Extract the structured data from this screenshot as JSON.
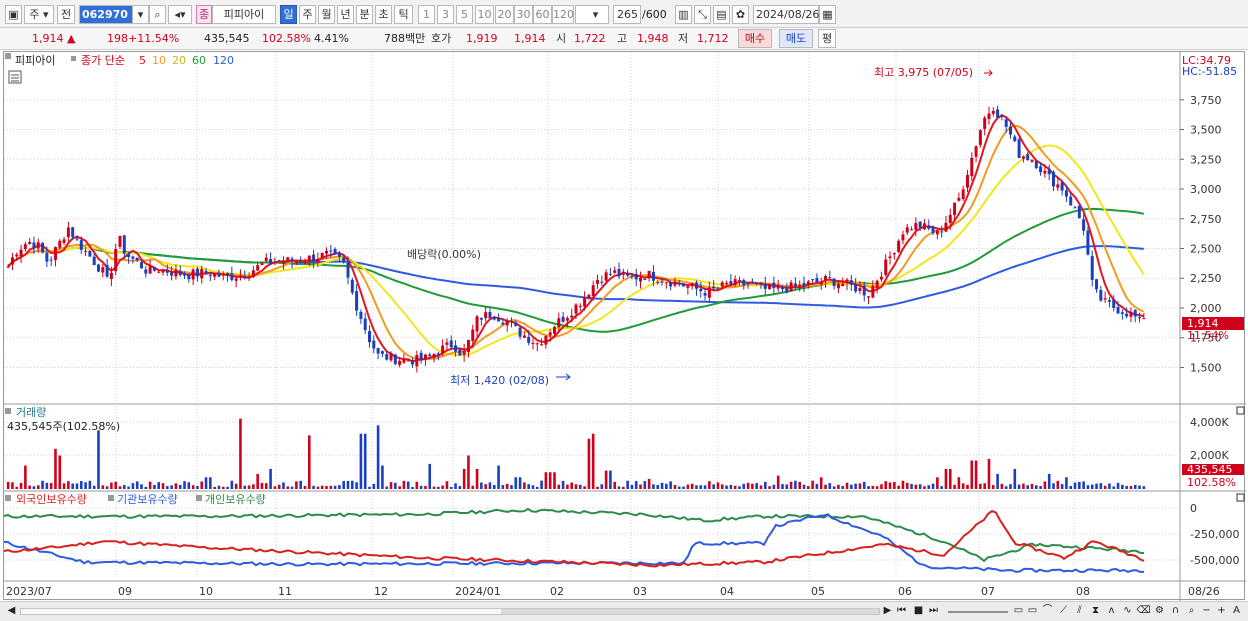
{
  "toolbar": {
    "market_type": "주",
    "prev_label": "전",
    "stock_code": "062970",
    "stock_badge": "종",
    "stock_name": "피피아이",
    "periods": [
      "일",
      "주",
      "월",
      "년",
      "분",
      "초",
      "틱"
    ],
    "active_period": "일",
    "intervals": [
      "1",
      "3",
      "5",
      "10",
      "20",
      "30",
      "60",
      "120"
    ],
    "count": "265",
    "count_total": "/600",
    "date": "2024/08/26"
  },
  "quote": {
    "price": "1,914",
    "change": "198",
    "change_pct": "+11.54%",
    "volume": "435,545",
    "volume_ratio": "102.58%",
    "turnover": "4.41%",
    "amount": "788백만",
    "ask_label": "호가",
    "ask": "1,919",
    "bid": "1,914",
    "open_label": "시",
    "open": "1,722",
    "high_label": "고",
    "high": "1,948",
    "low_label": "저",
    "low": "1,712",
    "buy_label": "매수",
    "sell_label": "매도",
    "avg_label": "평"
  },
  "chart_legend": {
    "name": "피피아이",
    "series_label": "종가 단순",
    "ma": [
      "5",
      "10",
      "20",
      "60",
      "120"
    ]
  },
  "colors": {
    "up": "#d0021b",
    "down": "#1a3fbf",
    "ma5": "#e8141c",
    "ma10": "#f39a1f",
    "ma20": "#f3e61b",
    "ma60": "#1f9b3a",
    "ma120": "#2e5be0",
    "foreign": "#d9211c",
    "institution": "#2e5be0",
    "individual": "#2f8a4d"
  },
  "annotations": {
    "high": "최고 3,975 (07/05)",
    "low": "최저 1,420 (02/08)",
    "dividend": "배당락(0.00%)",
    "lc": "LC:34.79",
    "hc": "HC:-51.85",
    "last_price": "1,914",
    "last_pct": "11.54%"
  },
  "volume_panel": {
    "title": "거래량",
    "value": "435,545주(102.58%)",
    "last_vol": "435,545",
    "last_pct": "102.58%"
  },
  "holding_panel": {
    "foreign": "외국인보유수량",
    "institution": "기관보유수량",
    "individual": "개인보유수량"
  },
  "chart_data": [
    {
      "type": "candlestick",
      "x": [
        "2023/07",
        "09",
        "10",
        "11",
        "12",
        "2024/01",
        "02",
        "03",
        "04",
        "05",
        "06",
        "07",
        "08",
        "08/26"
      ],
      "price_axis_ticks": [
        "3,750",
        "3,500",
        "3,250",
        "3,000",
        "2,750",
        "2,500",
        "2,250",
        "2,000",
        "1,750",
        "1,500"
      ],
      "high_point": {
        "value": 3975,
        "date": "07/05"
      },
      "low_point": {
        "value": 1420,
        "date": "02/08"
      },
      "last_close": 1914
    },
    {
      "type": "bar",
      "name": "거래량",
      "volume_axis_ticks": [
        "4,000K",
        "2,000K"
      ],
      "last_value": 435545
    },
    {
      "type": "line",
      "holding_axis_ticks": [
        "0",
        "-250,000",
        "-500,000"
      ],
      "series": [
        {
          "name": "외국인보유수량"
        },
        {
          "name": "기관보유수량"
        },
        {
          "name": "개인보유수량"
        }
      ]
    }
  ]
}
